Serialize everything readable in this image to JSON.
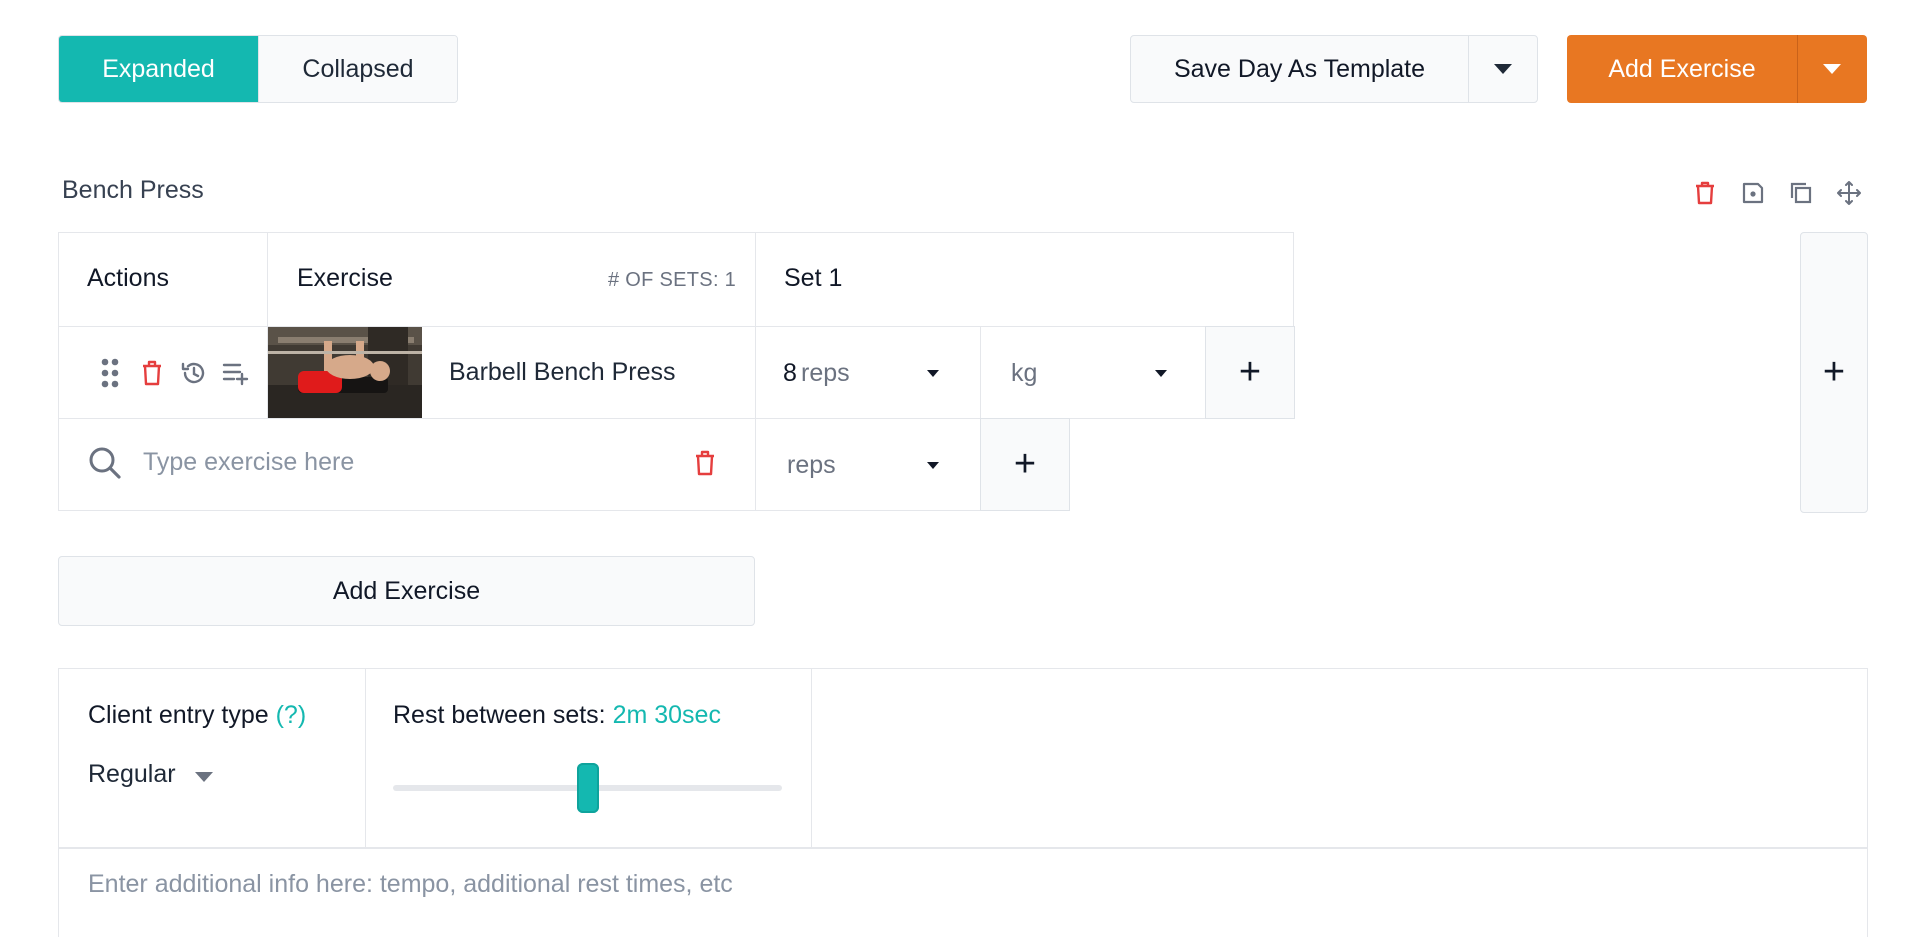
{
  "view_toggle": {
    "expanded": "Expanded",
    "collapsed": "Collapsed"
  },
  "toolbar": {
    "save_template": "Save Day As Template",
    "add_exercise": "Add Exercise"
  },
  "section": {
    "title": "Bench Press"
  },
  "table": {
    "headers": {
      "actions": "Actions",
      "exercise": "Exercise",
      "num_sets": "# OF SETS: 1",
      "set1": "Set 1"
    },
    "row": {
      "exercise_name": "Barbell Bench Press",
      "reps_value": "8",
      "reps_unit": "reps",
      "weight_unit": "kg"
    },
    "new_row": {
      "search_placeholder": "Type exercise here",
      "reps_unit": "reps"
    }
  },
  "add_exercise_button": "Add Exercise",
  "client_entry": {
    "label": "Client entry type",
    "help": "(?)",
    "value": "Regular"
  },
  "rest": {
    "label": "Rest between sets:",
    "value": "2m 30sec",
    "slider_fraction": 0.5
  },
  "notes": {
    "placeholder": "Enter additional info here: tempo, additional rest times, etc"
  },
  "colors": {
    "teal": "#14b8b0",
    "orange": "#e87722",
    "danger": "#e53e3e",
    "icon_gray": "#6b7280"
  },
  "plus_symbol": "+"
}
